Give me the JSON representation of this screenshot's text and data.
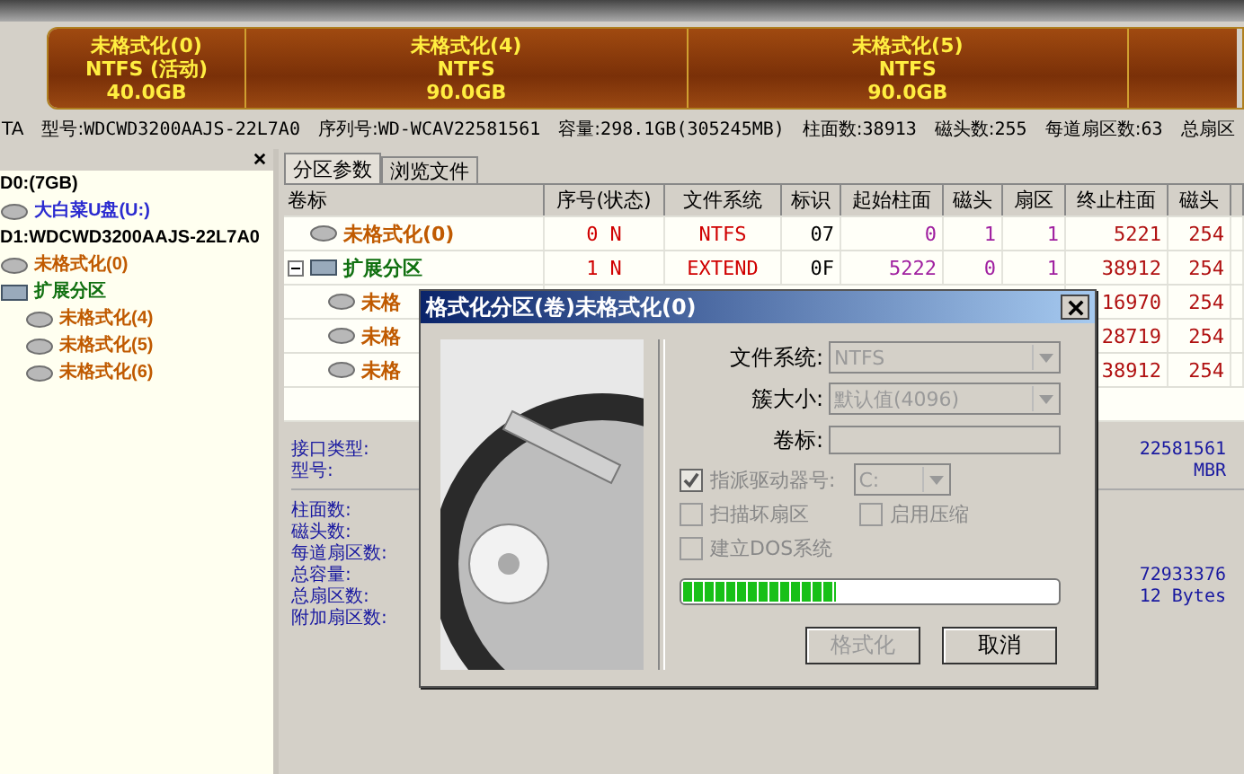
{
  "disk_map": {
    "partitions": [
      {
        "name": "未格式化(0)",
        "fs": "NTFS (活动)",
        "size": "40.0GB"
      },
      {
        "name": "未格式化(4)",
        "fs": "NTFS",
        "size": "90.0GB"
      },
      {
        "name": "未格式化(5)",
        "fs": "NTFS",
        "size": "90.0GB"
      }
    ]
  },
  "disk_info": [
    {
      "label": "TA"
    },
    {
      "label": "型号:",
      "value": "WDCWD3200AAJS-22L7A0"
    },
    {
      "label": "序列号:",
      "value": "WD-WCAV22581561"
    },
    {
      "label": "容量:",
      "value": "298.1GB(305245MB)"
    },
    {
      "label": "柱面数:",
      "value": "38913"
    },
    {
      "label": "磁头数:",
      "value": "255"
    },
    {
      "label": "每道扇区数:",
      "value": "63"
    },
    {
      "label": "总扇区"
    }
  ],
  "tree": [
    {
      "label": "D0:(7GB)",
      "children": [
        {
          "label": "大白菜U盘(U:)",
          "kind": "usb"
        }
      ]
    },
    {
      "label": "D1:WDCWD3200AAJS-22L7A0",
      "children": [
        {
          "label": "未格式化(0)",
          "kind": "partition"
        },
        {
          "label": "扩展分区",
          "kind": "extended",
          "children": [
            {
              "label": "未格式化(4)",
              "kind": "partition"
            },
            {
              "label": "未格式化(5)",
              "kind": "partition"
            },
            {
              "label": "未格式化(6)",
              "kind": "partition"
            }
          ]
        }
      ]
    }
  ],
  "tabs": [
    {
      "label": "分区参数",
      "selected": true
    },
    {
      "label": "浏览文件",
      "selected": false
    }
  ],
  "table": {
    "columns": [
      "卷标",
      "序号(状态)",
      "文件系统",
      "标识",
      "起始柱面",
      "磁头",
      "扇区",
      "终止柱面",
      "磁头"
    ],
    "rows": [
      {
        "kind": "partition",
        "label": "未格式化(0)",
        "cells": [
          "0 N",
          "NTFS",
          "07",
          "0",
          "1",
          "1",
          "5221",
          "254"
        ]
      },
      {
        "kind": "extended",
        "label": "扩展分区",
        "cells": [
          "1 N",
          "EXTEND",
          "0F",
          "5222",
          "0",
          "1",
          "38912",
          "254"
        ]
      },
      {
        "kind": "child",
        "label": "未格",
        "end_cells": [
          "16970",
          "254"
        ]
      },
      {
        "kind": "child",
        "label": "未格",
        "end_cells": [
          "28719",
          "254"
        ]
      },
      {
        "kind": "child",
        "label": "未格",
        "end_cells": [
          "38912",
          "254"
        ]
      }
    ]
  },
  "details": [
    [
      {
        "label": "接口类型:",
        "value": "22581561"
      },
      {
        "label": "型号:",
        "value": "MBR"
      }
    ],
    [
      {
        "label": "柱面数:"
      },
      {
        "label": "磁头数:"
      },
      {
        "label": "每道扇区数:"
      },
      {
        "label": "总容量:",
        "value": "72933376"
      },
      {
        "label": "总扇区数:",
        "value": "12 Bytes"
      },
      {
        "label": "附加扇区数:"
      }
    ]
  ],
  "dialog": {
    "title": "格式化分区(卷)未格式化(0)",
    "fields": [
      {
        "label": "文件系统:",
        "kind": "select",
        "value": "NTFS"
      },
      {
        "label": "簇大小:",
        "kind": "select",
        "value": "默认值(4096)"
      },
      {
        "label": "卷标:",
        "kind": "input"
      }
    ],
    "assign_letter": {
      "label": "指派驱动器号:",
      "checked": true,
      "value": "C:"
    },
    "options": [
      {
        "label": "扫描坏扇区",
        "checked": false
      },
      {
        "label": "启用压缩",
        "checked": false
      },
      {
        "label": "建立DOS系统",
        "checked": false
      }
    ],
    "progress": {
      "level": 0.41
    },
    "buttons": [
      {
        "label": "格式化",
        "disabled": true
      },
      {
        "label": "取消",
        "disabled": false
      }
    ]
  }
}
